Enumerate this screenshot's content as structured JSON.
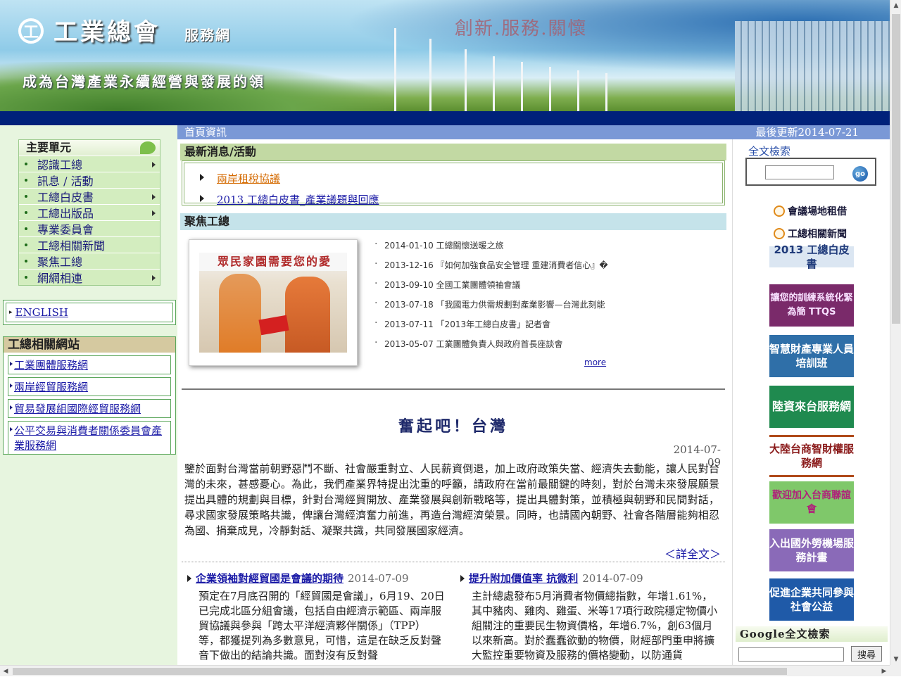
{
  "header": {
    "logo_symbol": "工",
    "logo_title": "工業總會",
    "logo_sub": "服務網",
    "slogan": "創新.服務.關懷",
    "tagline": "成為台灣產業永續經營與發展的領"
  },
  "infobar": {
    "home_label": "首頁資訊",
    "last_update": "最後更新2014-07-21"
  },
  "left_menu": {
    "title": "主要單元",
    "items": [
      {
        "label": "認識工總",
        "has_sub": true
      },
      {
        "label": "訊息 / 活動",
        "has_sub": false
      },
      {
        "label": "工總白皮書",
        "has_sub": true
      },
      {
        "label": "工總出版品",
        "has_sub": true
      },
      {
        "label": "專業委員會",
        "has_sub": false
      },
      {
        "label": "工總相關新聞",
        "has_sub": false
      },
      {
        "label": "聚焦工總",
        "has_sub": false
      },
      {
        "label": "網網相連",
        "has_sub": true
      }
    ],
    "english": "ENGLISH",
    "related_title": "工總相關網站",
    "related_links": [
      "工業團體服務網",
      "兩岸經貿服務網",
      "貿易發展組國際經貿服務網",
      "公平交易與消費者關係委員會產業服務網"
    ]
  },
  "news": {
    "title": "最新消息/活動",
    "items": [
      {
        "label": "兩岸租稅協議",
        "color": "#d46a00"
      },
      {
        "label": "2013 工總白皮書_產業議題與回應",
        "color": "#1a1aa6"
      }
    ]
  },
  "focus": {
    "title": "聚焦工總",
    "photo_banner": "眾民家園需要您的愛",
    "items": [
      "2014-01-10  工總關懷送暖之旅",
      "2013-12-16  『如何加強食品安全管理 重建消費者信心』�",
      "2013-09-10  全國工業團體領袖會議",
      "2013-07-18  「我國電力供需規劃對產業影響—台灣此刻能",
      "2013-07-11  「2013年工總白皮書」記者會",
      "2013-05-07  工業團體負責人與政府首長座談會"
    ],
    "more": "more"
  },
  "article": {
    "title": "奮起吧！台灣",
    "date": "2014-07-09",
    "body": "鑒於面對台灣當前朝野惡鬥不斷、社會嚴重對立、人民薪資倒退，加上政府政策失當、經濟失去動能，讓人民對台灣的未來，甚感憂心。為此，我們產業界特提出沈重的呼籲，請政府在當前最關鍵的時刻，對於台灣未來發展願景提出具體的規劃與目標，針對台灣經貿開放、產業發展與創新戰略等，提出具體對策，並積極與朝野和民間對話，尋求國家發展策略共識，俾讓台灣經濟奮力前進，再造台灣經濟榮景。同時，也請國內朝野、社會各階層能夠相忍為國、捐棄成見，冷靜對話、凝聚共識，共同發展國家經濟。",
    "detail": "＜詳全文＞"
  },
  "columns": [
    {
      "title": "企業領袖對經貿國是會議的期待",
      "date": "2014-07-09",
      "body": "預定在7月底召開的「經貿國是會議」，6月19、20日已完成北區分組會議，包括自由經濟示範區、兩岸服貿協議與參與「跨太平洋經濟夥伴關係」（TPP）等，都獲提列為多數意見，可惜，這是在缺乏反對聲音下做出的結論共識。面對沒有反對聲"
    },
    {
      "title": "提升附加價值率 抗微利",
      "date": "2014-07-09",
      "body": "主計總處發布5月消費者物價總指數，年增1.61%，其中豬肉、雞肉、雞蛋、米等17項行政院穩定物價小組關注的重要民生物資價格，年增6.7%，創63個月以來新高。對於蠢蠢欲動的物價，財經部門重申將擴大監控重要物資及服務的價格變動，以防通貨"
    }
  ],
  "right": {
    "search_label": "全文檢索",
    "go_label": "go",
    "links": [
      "會議場地租借",
      "工總相關新聞"
    ],
    "banners": [
      {
        "text": "2013 工總白皮書",
        "bg": "#dbe6f2",
        "fg": "#1f3a7a"
      },
      {
        "text": "讓您的訓練系統化緊為簡 TTQS",
        "bg": "#7a2a6a",
        "fg": "#f8e0ff"
      },
      {
        "text": "智慧財產專業人員培訓班",
        "bg": "#2f6fa8",
        "fg": "#ffffff"
      },
      {
        "text": "陸資來台服務網",
        "bg": "#1f8a4f",
        "fg": "#ffffff"
      },
      {
        "text": "大陸台商智財權服務網",
        "bg": "#ffffff",
        "fg": "#8a1a1a"
      },
      {
        "text": "歡迎加入台商聯誼會",
        "bg": "#7fc86a",
        "fg": "#b0207a"
      },
      {
        "text": "入出國外勞機場服務計畫",
        "bg": "#8a6ab8",
        "fg": "#ffffff"
      },
      {
        "text": "促進企業共同參與社會公益",
        "bg": "#1f5aa8",
        "fg": "#ffffff"
      }
    ],
    "google_title": "Google全文檢索",
    "google_button": "搜尋"
  }
}
